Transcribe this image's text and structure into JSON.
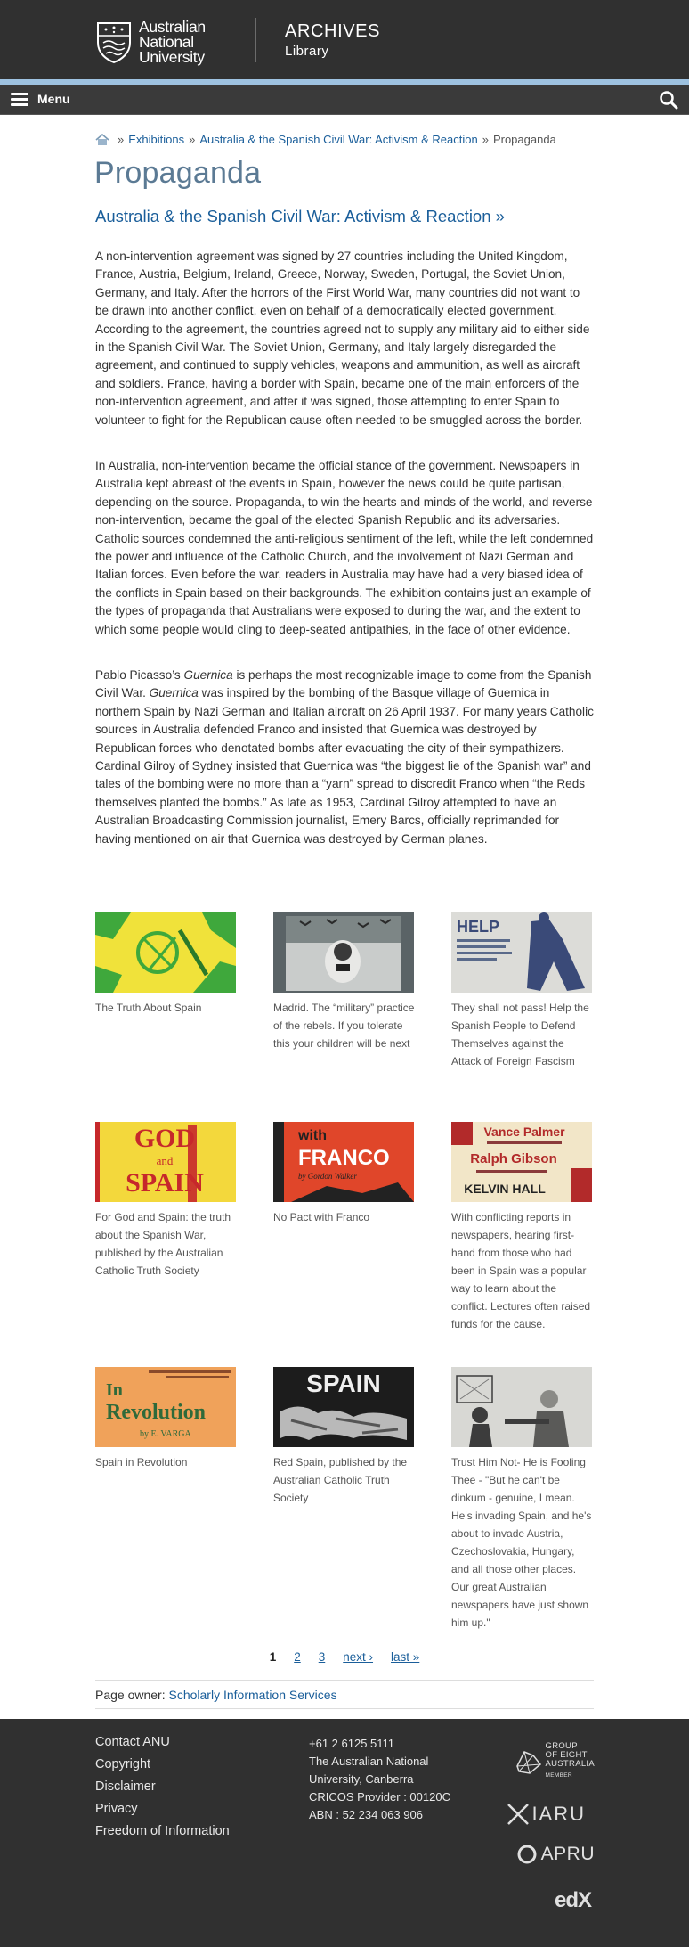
{
  "header": {
    "university_name": [
      "Australian",
      "National",
      "University"
    ],
    "section_title": "ARCHIVES",
    "section_subtitle": "Library",
    "menu_label": "Menu"
  },
  "breadcrumb": {
    "items": [
      "Exhibitions",
      "Australia & the Spanish Civil War: Activism & Reaction"
    ],
    "current": "Propaganda"
  },
  "page": {
    "title": "Propaganda",
    "parent_link": "Australia & the Spanish Civil War: Activism & Reaction »"
  },
  "body": {
    "p1": "A non-intervention agreement was signed by 27 countries including the United Kingdom, France, Austria, Belgium, Ireland, Greece, Norway, Sweden, Portugal, the Soviet Union, Germany, and Italy. After the horrors of the First World War, many countries did not want to be drawn into another conflict, even on behalf of a democratically elected government. According to the agreement, the countries agreed not to supply any military aid to either side in the Spanish Civil War. The Soviet Union, Germany, and Italy largely disregarded the agreement, and continued to supply vehicles, weapons and ammunition, as well as aircraft and soldiers. France, having a border with Spain, became one of the main enforcers of the non-intervention agreement, and after it was signed, those attempting to enter Spain to volunteer to fight for the Republican cause often needed to be smuggled across the border.",
    "p2": "In Australia, non-intervention became the official stance of the government. Newspapers in Australia kept abreast of the events in Spain, however the news could be quite partisan, depending on the source. Propaganda, to win the hearts and minds of the world, and reverse non-intervention, became the goal of the elected Spanish Republic and its adversaries. Catholic sources condemned the anti-religious sentiment of the left, while the left condemned the power and influence of the Catholic Church, and the involvement of Nazi German and Italian forces. Even before the war, readers in Australia may have had a very biased idea of the conflicts in Spain based on their backgrounds. The exhibition contains just an example of the types of propaganda that Australians were exposed to during the war, and the extent to which some people would cling to deep-seated antipathies, in the face of other evidence.",
    "p3_a": "Pablo Picasso’s ",
    "p3_em1": "Guernica",
    "p3_b": " is perhaps the most recognizable image to come from the Spanish Civil War. ",
    "p3_em2": "Guernica",
    "p3_c": " was inspired by the bombing of the Basque village of Guernica in northern Spain by Nazi German and Italian aircraft on 26 April 1937. For many years Catholic sources in Australia defended Franco and insisted that Guernica was destroyed by Republican forces who denotated bombs after evacuating the city of their sympathizers. Cardinal Gilroy of Sydney insisted that Guernica was “the biggest lie of the Spanish war” and tales of the bombing were no more than a “yarn” spread to discredit Franco when “the Reds themselves planted the bombs.” As late as 1953, Cardinal Gilroy attempted to have an Australian Broadcasting Commission journalist, Emery Barcs, officially reprimanded for having mentioned on air that Guernica was destroyed by German planes."
  },
  "gallery": [
    {
      "caption": "The Truth About Spain",
      "colors": [
        "#f0e23a",
        "#3fa83c"
      ]
    },
    {
      "caption": "Madrid. The “military” practice of the rebels. If you tolerate this your children will be next",
      "colors": [
        "#5a6366",
        "#c9cccb"
      ]
    },
    {
      "caption": "They shall not pass! Help the Spanish People to Defend Themselves against the Attack of Foreign Fascism",
      "colors": [
        "#dcdcd8",
        "#3a4a78"
      ],
      "text": "HELP"
    },
    {
      "caption": "For God and Spain: the truth about the Spanish War, published by the Australian Catholic Truth Society",
      "colors": [
        "#f3d83c",
        "#c6282b"
      ],
      "text": [
        "GOD",
        "and",
        "SPAIN"
      ]
    },
    {
      "caption": "No Pact with Franco",
      "colors": [
        "#e0462a",
        "#222222"
      ],
      "text": [
        "with",
        "FRANCO",
        "by Gordon Walker"
      ]
    },
    {
      "caption": "With conflicting reports in newspapers, hearing first-hand from those who had been in Spain was a popular way to learn about the conflict. Lectures often raised funds for the cause.",
      "colors": [
        "#f2e6c8",
        "#b22a2a"
      ],
      "text": [
        "Vance Palmer",
        "Ralph Gibson",
        "KELVIN HALL"
      ]
    },
    {
      "caption": "Spain in Revolution",
      "colors": [
        "#f0a25a",
        "#2f6a3a"
      ],
      "text": [
        "In",
        "Revolution",
        "by E. VARGA"
      ]
    },
    {
      "caption": "Red Spain, published by the Australian Catholic Truth Society",
      "colors": [
        "#1c1c1c",
        "#b9b9b9"
      ],
      "text": "SPAIN"
    },
    {
      "caption": "Trust Him Not- He is Fooling Thee - \"But he can't be dinkum - genuine, I mean. He's invading Spain, and he's about to invade Austria, Czechoslovakia, Hungary, and all those other places. Our great Australian newspapers have just shown him up.\"",
      "colors": [
        "#d8d8d4",
        "#3c3c3c"
      ]
    }
  ],
  "pager": {
    "current": "1",
    "pages": [
      "2",
      "3"
    ],
    "next": "next ›",
    "last": "last »"
  },
  "owner": {
    "label": "Page owner: ",
    "link": "Scholarly Information Services"
  },
  "footer": {
    "links": [
      "Contact ANU",
      "Copyright",
      "Disclaimer",
      "Privacy",
      "Freedom of Information"
    ],
    "contact": [
      "+61 2 6125 5111",
      "The Australian National",
      "University, Canberra",
      "CRICOS Provider : 00120C",
      "ABN : 52 234 063 906"
    ],
    "logos": {
      "go8": [
        "GROUP",
        "OF EIGHT",
        "AUSTRALIA",
        "MEMBER"
      ],
      "iaru": "IARU",
      "apru": "APRU",
      "edx": "edX"
    }
  }
}
